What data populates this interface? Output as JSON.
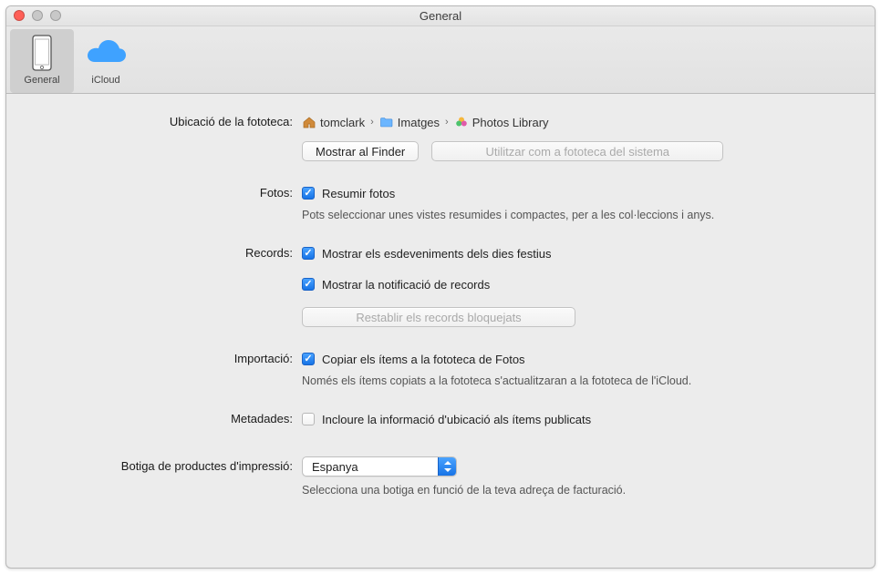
{
  "window": {
    "title": "General"
  },
  "toolbar": {
    "items": [
      {
        "id": "general",
        "label": "General",
        "selected": true
      },
      {
        "id": "icloud",
        "label": "iCloud",
        "selected": false
      }
    ]
  },
  "library": {
    "label": "Ubicació de la fototeca:",
    "breadcrumb": [
      "tomclark",
      "Imatges",
      "Photos Library"
    ],
    "show_in_finder": "Mostrar al Finder",
    "use_as_system": "Utilitzar com a fototeca del sistema"
  },
  "photos": {
    "label": "Fotos:",
    "summarize": {
      "checked": true,
      "text": "Resumir fotos"
    },
    "caption": "Pots seleccionar unes vistes resumides i compactes, per a les col·leccions i anys."
  },
  "memories": {
    "label": "Records:",
    "holidays": {
      "checked": true,
      "text": "Mostrar els esdeveniments dels dies festius"
    },
    "notify": {
      "checked": true,
      "text": "Mostrar la notificació de records"
    },
    "reset_button": "Restablir els records bloquejats"
  },
  "importing": {
    "label": "Importació:",
    "copy": {
      "checked": true,
      "text": "Copiar els ítems a la fototeca de Fotos"
    },
    "caption": "Només els ítems copiats a la fototeca s'actualitzaran a la fototeca de l'iCloud."
  },
  "metadata": {
    "label": "Metadades:",
    "include_location": {
      "checked": false,
      "text": "Incloure la informació d'ubicació als ítems publicats"
    }
  },
  "store": {
    "label": "Botiga de productes d'impressió:",
    "value": "Espanya",
    "caption": "Selecciona una botiga en funció de la teva adreça de facturació."
  }
}
